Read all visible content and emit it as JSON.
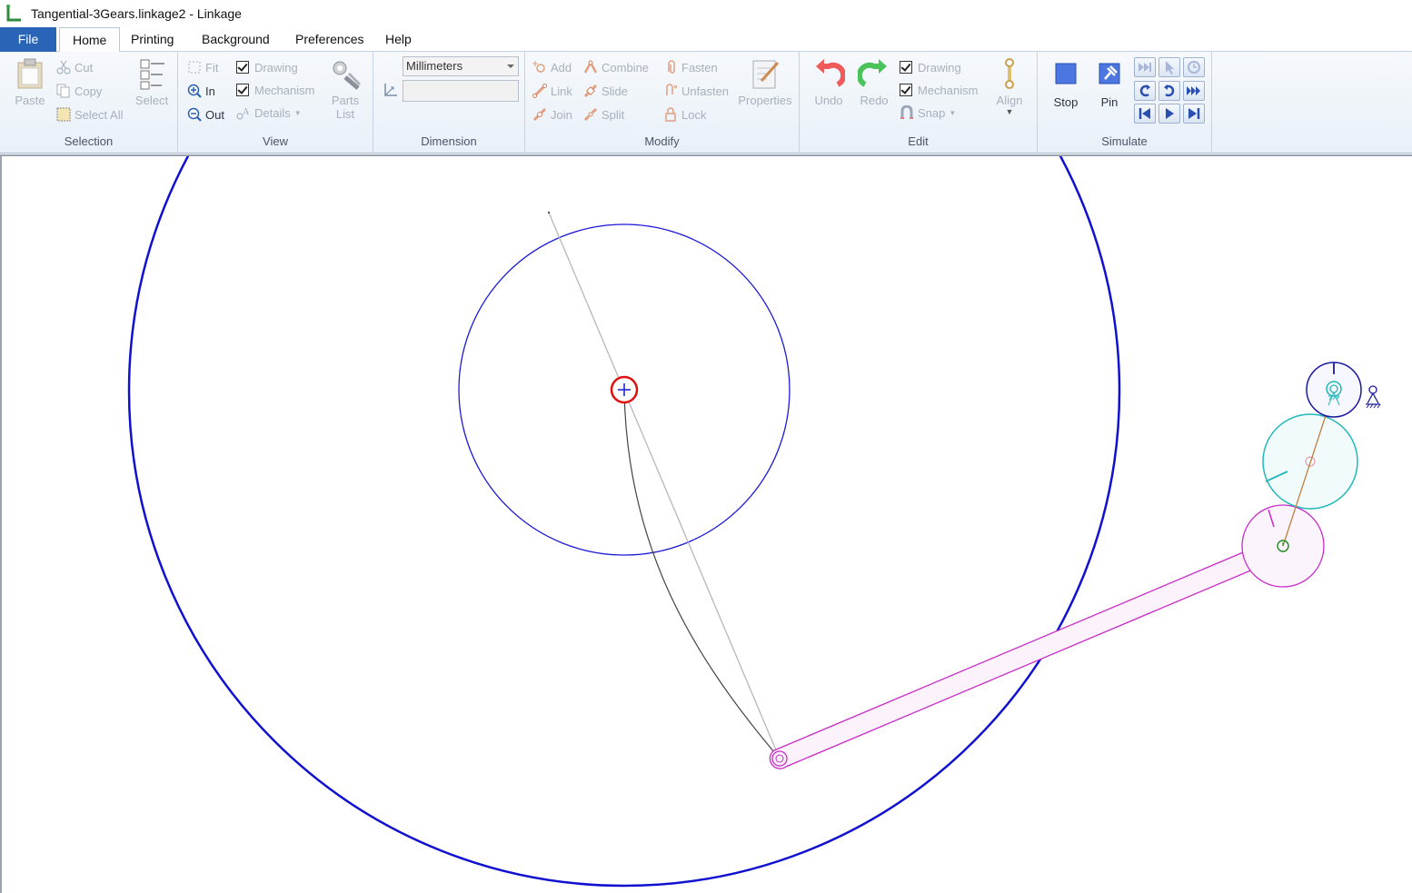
{
  "window": {
    "title": "Tangential-3Gears.linkage2 - Linkage"
  },
  "menu": {
    "tabs": [
      {
        "label": "File"
      },
      {
        "label": "Home"
      },
      {
        "label": "Printing"
      },
      {
        "label": "Background"
      },
      {
        "label": "Preferences"
      },
      {
        "label": "Help"
      }
    ],
    "active_tab": "Home"
  },
  "ribbon": {
    "selection": {
      "group_label": "Selection",
      "paste": "Paste",
      "cut": "Cut",
      "copy": "Copy",
      "select_all": "Select All",
      "select": "Select"
    },
    "view": {
      "group_label": "View",
      "fit": "Fit",
      "zoom_in": "In",
      "zoom_out": "Out",
      "drawing": "Drawing",
      "mechanism": "Mechanism",
      "details": "Details",
      "parts_list": "Parts List"
    },
    "dimension": {
      "group_label": "Dimension",
      "units": "Millimeters",
      "value": ""
    },
    "modify": {
      "group_label": "Modify",
      "add": "Add",
      "link": "Link",
      "join": "Join",
      "combine": "Combine",
      "slide": "Slide",
      "split": "Split",
      "fasten": "Fasten",
      "unfasten": "Unfasten",
      "lock": "Lock",
      "properties": "Properties"
    },
    "edit": {
      "group_label": "Edit",
      "undo": "Undo",
      "redo": "Redo",
      "drawing": "Drawing",
      "mechanism": "Mechanism",
      "snap": "Snap",
      "align": "Align"
    },
    "simulate": {
      "group_label": "Simulate",
      "stop": "Stop",
      "pin": "Pin"
    }
  },
  "colors": {
    "file_tab": "#2a64b7",
    "large_gear": "#1010d0",
    "small_gear": "#1a1ad8",
    "magenta_link": "#c82bc8",
    "teal_gear": "#20b8b8",
    "selected_anchor": "#e01010",
    "coupler_path": "#444444",
    "guide_line": "#b8b8b8",
    "brown_link": "#c08040"
  }
}
